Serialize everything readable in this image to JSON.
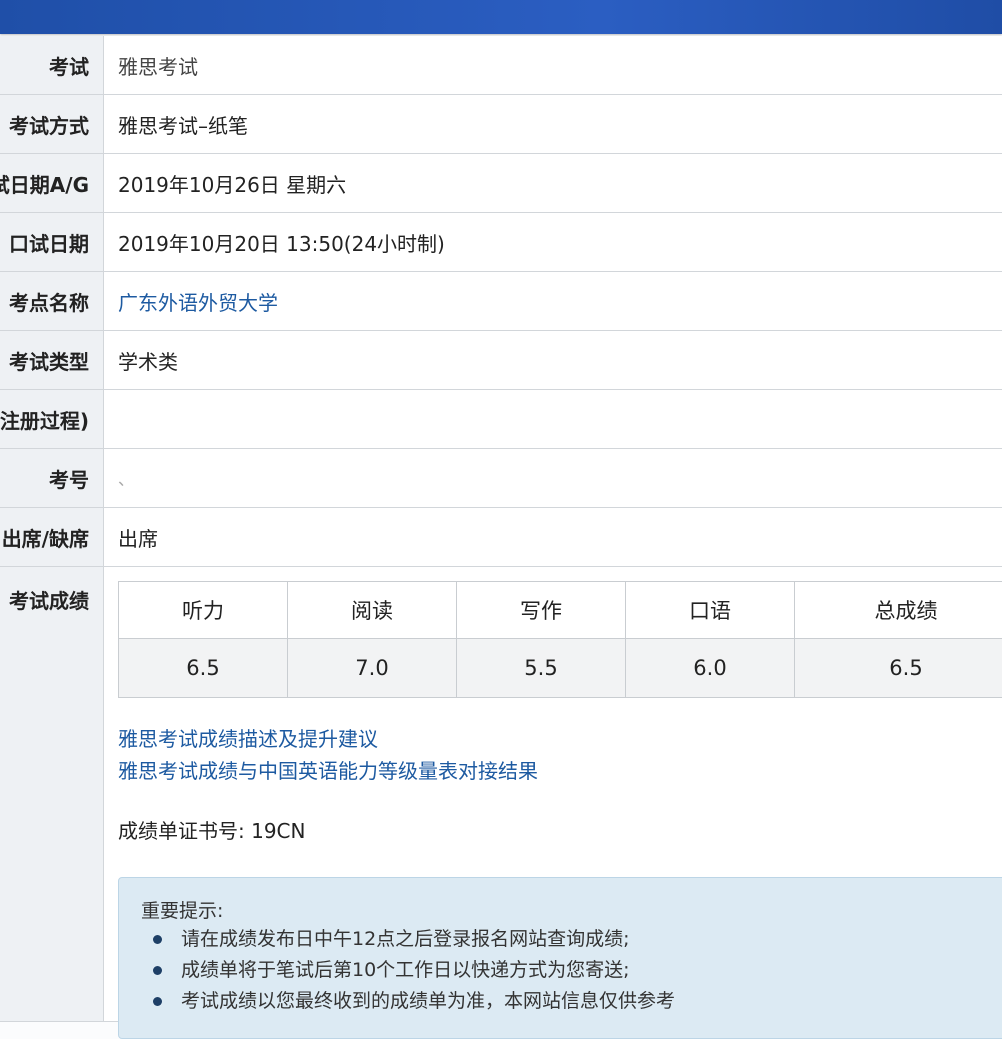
{
  "rows": [
    {
      "label": "考试",
      "value": "雅思考试"
    },
    {
      "label": "考试方式",
      "value": "雅思考试–纸笔"
    },
    {
      "label": "笔试日期A/G",
      "value": "2019年10月26日 星期六"
    },
    {
      "label": "口试日期",
      "value": "2019年10月20日 13:50(24小时制)"
    },
    {
      "label": "考点名称",
      "value": "广东外语外贸大学"
    },
    {
      "label": "考试类型",
      "value": "学术类"
    },
    {
      "label": "(注册过程)",
      "value": ""
    },
    {
      "label": "考号",
      "value": "、"
    },
    {
      "label": "出席/缺席",
      "value": "出席"
    }
  ],
  "scores": {
    "label": "考试成绩",
    "headers": [
      "听力",
      "阅读",
      "写作",
      "口语",
      "总成绩"
    ],
    "values": [
      "6.5",
      "7.0",
      "5.5",
      "6.0",
      "6.5"
    ]
  },
  "links": [
    "雅思考试成绩描述及提升建议",
    "雅思考试成绩与中国英语能力等级量表对接结果"
  ],
  "certificate": "成绩单证书号: 19CN",
  "notice": {
    "title": "重要提示:",
    "items": [
      "请在成绩发布日中午12点之后登录报名网站查询成绩;",
      "成绩单将于笔试后第10个工作日以快递方式为您寄送;",
      "考试成绩以您最终收到的成绩单为准，本网站信息仅供参考"
    ]
  },
  "colors": {
    "header_bar": "#2b5ec2",
    "link": "#1d5aa1",
    "notice_bg": "#dceaf3"
  }
}
